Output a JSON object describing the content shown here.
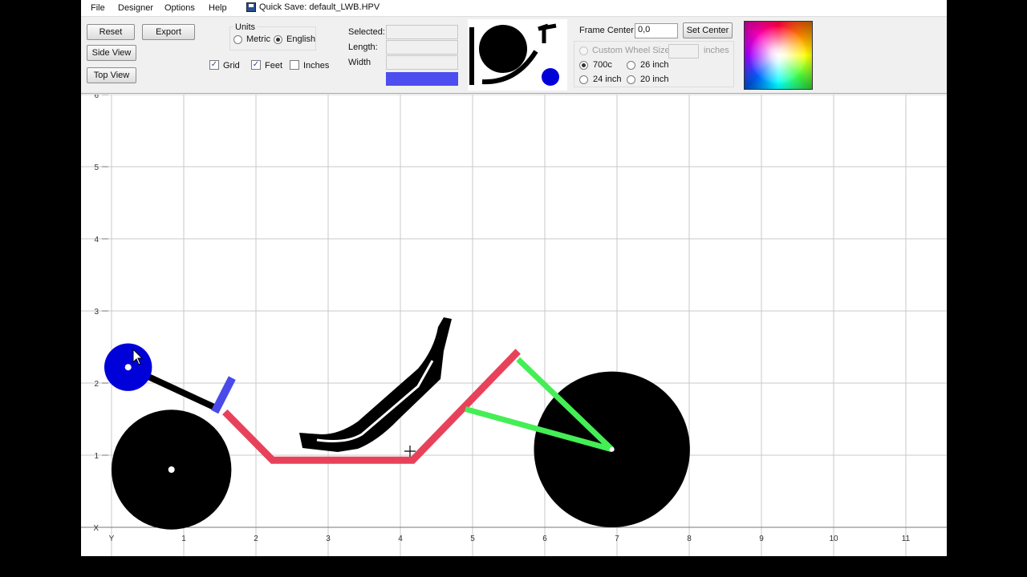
{
  "menu": {
    "file": "File",
    "designer": "Designer",
    "options": "Options",
    "help": "Help",
    "quick_save": "Quick Save: default_LWB.HPV"
  },
  "toolbar": {
    "reset": "Reset",
    "export": "Export",
    "side_view": "Side View",
    "top_view": "Top View",
    "units_title": "Units",
    "metric": "Metric",
    "english": "English",
    "units_selected": "English",
    "grid": "Grid",
    "feet": "Feet",
    "inches": "Inches",
    "grid_checked": true,
    "feet_checked": true,
    "inches_checked": false,
    "selected_label": "Selected:",
    "length_label": "Length:",
    "width_label": "Width",
    "selected_value": "",
    "length_value": "",
    "width_value": "",
    "swatch_color": "#4d4df0",
    "frame_center_label": "Frame Center",
    "frame_center_value": "0,0",
    "set_center": "Set Center",
    "custom_wheel_size": "Custom Wheel Size",
    "custom_wheel_unit": "inches",
    "wheel_700c": "700c",
    "wheel_26": "26 inch",
    "wheel_24": "24 inch",
    "wheel_20": "20 inch",
    "wheel_selected": "700c"
  },
  "canvas": {
    "x_ticks": [
      "Y",
      "1",
      "2",
      "3",
      "4",
      "5",
      "6",
      "7",
      "8",
      "9",
      "10",
      "11"
    ],
    "y_ticks": [
      "X",
      "1",
      "2",
      "3",
      "4",
      "5",
      "6"
    ],
    "colors": {
      "frame": "#e8425a",
      "rear_triangle": "#44ee55",
      "wheel": "#000000",
      "head_tube": "#4a4aea",
      "chainring": "#0000d8",
      "boom": "#000000",
      "seat": "#000000"
    },
    "design": {
      "front_wheel": {
        "x": 0.83,
        "y": 0.8,
        "r": 0.83
      },
      "rear_wheel": {
        "x": 6.93,
        "y": 1.08,
        "r": 1.08
      },
      "chainring": {
        "x": 0.23,
        "y": 2.22,
        "r": 0.33
      },
      "frame_points": [
        [
          1.57,
          1.6
        ],
        [
          2.23,
          0.93
        ],
        [
          4.17,
          0.93
        ],
        [
          5.63,
          2.44
        ]
      ],
      "rear_triangle": [
        [
          5.63,
          2.33
        ],
        [
          6.93,
          1.08
        ],
        [
          4.9,
          1.64
        ]
      ],
      "head_tube": [
        [
          1.43,
          1.6
        ],
        [
          1.67,
          2.07
        ]
      ],
      "boom": [
        [
          0.23,
          2.22
        ],
        [
          1.5,
          1.63
        ]
      ]
    }
  }
}
